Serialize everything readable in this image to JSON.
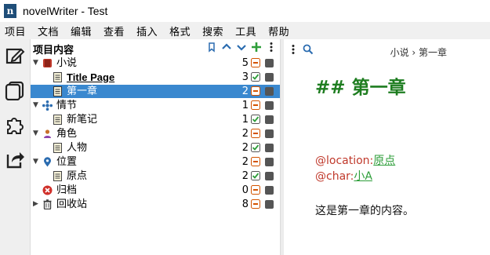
{
  "window": {
    "title": "novelWriter - Test",
    "app_icon_letter": "n"
  },
  "menu": [
    {
      "label": "项目"
    },
    {
      "label": "文档"
    },
    {
      "label": "编辑"
    },
    {
      "label": "查看"
    },
    {
      "label": "插入"
    },
    {
      "label": "格式"
    },
    {
      "label": "搜索"
    },
    {
      "label": "工具"
    },
    {
      "label": "帮助"
    }
  ],
  "sidebar": {
    "buttons": [
      {
        "name": "project-tree-view-button",
        "icon": "edit-icon"
      },
      {
        "name": "novel-view-button",
        "icon": "panels-icon"
      },
      {
        "name": "outline-view-button",
        "icon": "puzzle-icon"
      },
      {
        "name": "export-button",
        "icon": "export-icon"
      }
    ]
  },
  "project_tree": {
    "title": "项目内容",
    "tools": [
      "bookmark-icon",
      "move-up-icon",
      "move-down-icon",
      "add-icon",
      "menu-icon"
    ],
    "rows": [
      {
        "label": "小说",
        "count": "5",
        "icon": "novel-root-icon",
        "depth": 0,
        "expanded": true,
        "bold": false,
        "selected": false,
        "status_color": "#c0392b"
      },
      {
        "label": "Title Page",
        "count": "3",
        "icon": "document-icon",
        "depth": 1,
        "bold": true,
        "selected": false,
        "status": "check"
      },
      {
        "label": "第一章",
        "count": "2",
        "icon": "document-icon",
        "depth": 1,
        "bold": false,
        "selected": true,
        "status": "minus"
      },
      {
        "label": "情节",
        "count": "1",
        "icon": "plot-icon",
        "depth": 0,
        "expanded": true,
        "bold": false,
        "selected": false,
        "status": "minus"
      },
      {
        "label": "新笔记",
        "count": "1",
        "icon": "document-icon",
        "depth": 1,
        "bold": false,
        "selected": false,
        "status": "check"
      },
      {
        "label": "角色",
        "count": "2",
        "icon": "character-icon",
        "depth": 0,
        "expanded": true,
        "bold": false,
        "selected": false,
        "status": "minus"
      },
      {
        "label": "人物",
        "count": "2",
        "icon": "document-icon",
        "depth": 1,
        "bold": false,
        "selected": false,
        "status": "check"
      },
      {
        "label": "位置",
        "count": "2",
        "icon": "location-icon",
        "depth": 0,
        "expanded": true,
        "bold": false,
        "selected": false,
        "status": "minus"
      },
      {
        "label": "原点",
        "count": "2",
        "icon": "document-icon",
        "depth": 1,
        "bold": false,
        "selected": false,
        "status": "check"
      },
      {
        "label": "归档",
        "count": "0",
        "icon": "archive-icon",
        "depth": 0,
        "expanded": false,
        "bold": false,
        "selected": false,
        "status": "minus"
      },
      {
        "label": "回收站",
        "count": "8",
        "icon": "trash-icon",
        "depth": 0,
        "expanded": false,
        "collapsed": true,
        "bold": false,
        "selected": false,
        "status": "minus"
      }
    ]
  },
  "document": {
    "breadcrumb": "小说 › 第一章",
    "heading_hash": "##",
    "heading": "第一章",
    "tags": [
      {
        "keyword": "@location:",
        "value": "原点"
      },
      {
        "keyword": "@char:",
        "value": "小A"
      }
    ],
    "body": "这是第一章的内容。"
  },
  "colors": {
    "selection": "#3a88cf",
    "heading": "#1e7d20",
    "keyword": "#c0392b",
    "keyword_value": "#2e9e3a"
  }
}
